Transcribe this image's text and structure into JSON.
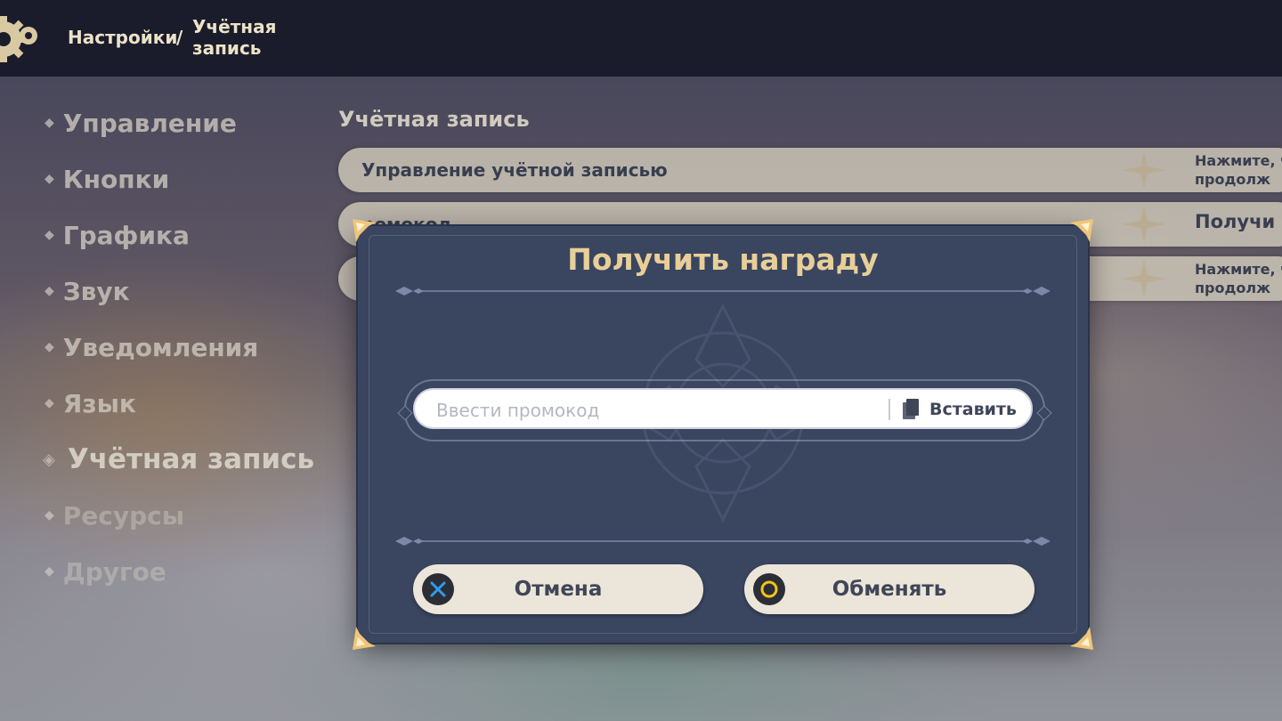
{
  "header": {
    "breadcrumb_root": "Настройки",
    "breadcrumb_separator": "/",
    "breadcrumb_current": "Учётная запись",
    "icon": "gear-icon"
  },
  "sidebar": {
    "items": [
      {
        "label": "Управление"
      },
      {
        "label": "Кнопки"
      },
      {
        "label": "Графика"
      },
      {
        "label": "Звук"
      },
      {
        "label": "Уведомления"
      },
      {
        "label": "Язык"
      },
      {
        "label": "Учётная запись",
        "active": true
      },
      {
        "label": "Ресурсы"
      },
      {
        "label": "Другое"
      }
    ]
  },
  "main": {
    "section_title": "Учётная запись",
    "rows": [
      {
        "label": "Управление учётной записью",
        "value": "Нажмите, ч\nпродолж"
      },
      {
        "label": "ромокод",
        "value": "Получи"
      },
      {
        "label": "",
        "value": "Нажмите, ч\nпродолж"
      }
    ]
  },
  "dialog": {
    "title": "Получить награду",
    "input_placeholder": "Ввести промокод",
    "input_value": "",
    "paste_label": "Вставить",
    "cancel_label": "Отмена",
    "confirm_label": "Обменять"
  },
  "colors": {
    "dialog_bg": "#3a4560",
    "title_gold": "#e8cf98",
    "button_bg": "#ece5d9",
    "cancel_icon": "#2f9bf0",
    "confirm_icon": "#f2c418"
  }
}
